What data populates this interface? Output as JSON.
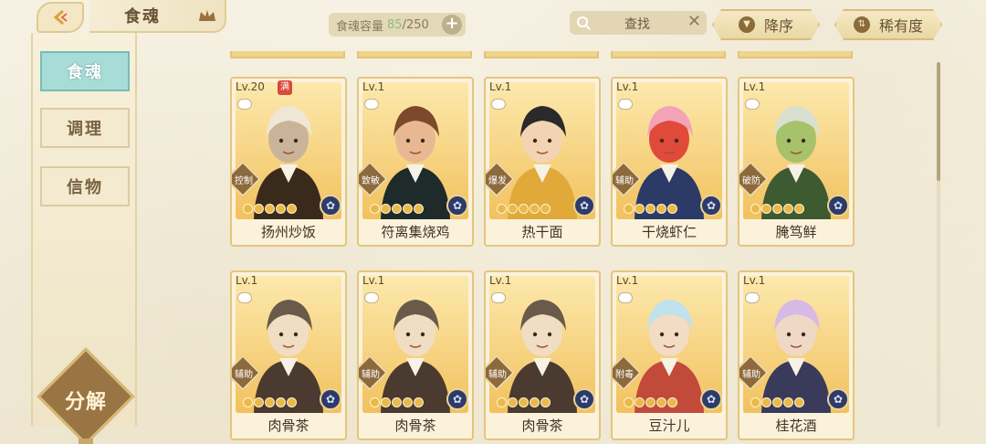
{
  "header": {
    "title": "食魂",
    "capacity_label": "食魂容量",
    "capacity_current": "85",
    "capacity_max": "/250",
    "search_label": "查找",
    "sort_order_label": "降序",
    "sort_by_label": "稀有度"
  },
  "sidebar": {
    "items": [
      {
        "label": "食魂",
        "active": true
      },
      {
        "label": "调理",
        "active": false
      },
      {
        "label": "信物",
        "active": false
      }
    ],
    "decompose_label": "分解"
  },
  "cards": [
    {
      "level": "Lv.20",
      "full": "满",
      "role": "控制",
      "name": "扬州炒饭",
      "rarity_on": 5,
      "palette": [
        "#efe6d6",
        "#3a2a1c",
        "#c9b49a"
      ]
    },
    {
      "level": "Lv.1",
      "role": "致敏",
      "name": "符离集烧鸡",
      "rarity_on": 5,
      "palette": [
        "#7a4a2a",
        "#1f2a2a",
        "#e8b893"
      ]
    },
    {
      "level": "Lv.1",
      "role": "爆发",
      "name": "热干面",
      "rarity_on": 5,
      "palette": [
        "#2a2a2a",
        "#e0a93a",
        "#f2d4b5"
      ]
    },
    {
      "level": "Lv.1",
      "role": "辅助",
      "name": "干烧虾仁",
      "rarity_on": 5,
      "palette": [
        "#f2a4b6",
        "#2b3a66",
        "#e04a3a"
      ]
    },
    {
      "level": "Lv.1",
      "role": "破防",
      "name": "腌笃鲜",
      "rarity_on": 5,
      "palette": [
        "#d9e0d0",
        "#3d5a30",
        "#a6c26a"
      ]
    },
    {
      "level": "Lv.1",
      "role": "辅助",
      "name": "肉骨茶",
      "rarity_on": 5,
      "palette": [
        "#6a5a4a",
        "#4a3a30",
        "#f0ddc4"
      ]
    },
    {
      "level": "Lv.1",
      "role": "辅助",
      "name": "肉骨茶",
      "rarity_on": 5,
      "palette": [
        "#6a5a4a",
        "#4a3a30",
        "#f0ddc4"
      ]
    },
    {
      "level": "Lv.1",
      "role": "辅助",
      "name": "肉骨茶",
      "rarity_on": 5,
      "palette": [
        "#6a5a4a",
        "#4a3a30",
        "#f0ddc4"
      ]
    },
    {
      "level": "Lv.1",
      "role": "附毒",
      "name": "豆汁儿",
      "rarity_on": 5,
      "palette": [
        "#bfe2ec",
        "#c24a3a",
        "#f2dcc4"
      ]
    },
    {
      "level": "Lv.1",
      "role": "辅助",
      "name": "桂花酒",
      "rarity_on": 5,
      "palette": [
        "#d7b9e6",
        "#3a3a5a",
        "#f0d8c6"
      ]
    }
  ],
  "colors": {
    "accent_teal": "#a8dcd7",
    "capacity_green": "#8cc07a",
    "gold": "#e5c57d"
  }
}
